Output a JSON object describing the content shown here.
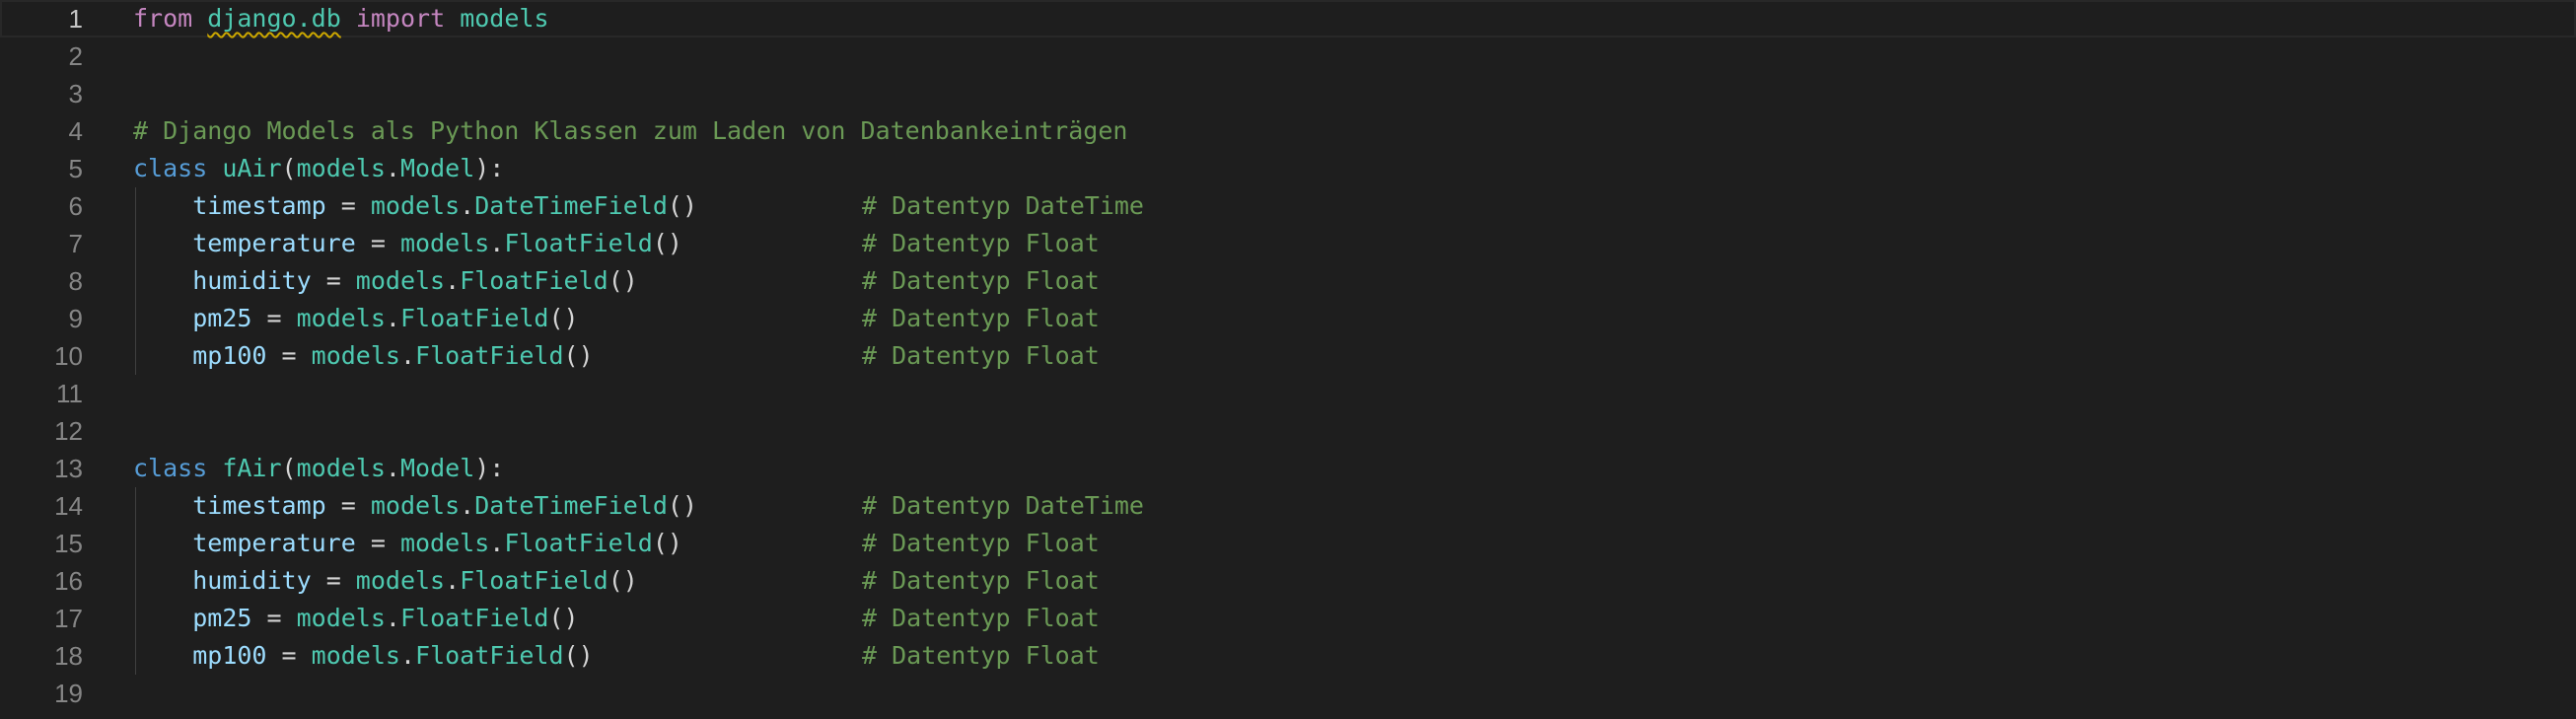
{
  "editor": {
    "current_line": 1,
    "lines": [
      {
        "no": "1",
        "tokens": [
          {
            "t": "from",
            "c": "tok-kw-ctrl"
          },
          {
            "t": " ",
            "c": "tok-plain"
          },
          {
            "t": "django.db",
            "c": "tok-mod squiggle"
          },
          {
            "t": " ",
            "c": "tok-plain"
          },
          {
            "t": "import",
            "c": "tok-kw-ctrl"
          },
          {
            "t": " ",
            "c": "tok-plain"
          },
          {
            "t": "models",
            "c": "tok-mod"
          }
        ],
        "comment": ""
      },
      {
        "no": "2",
        "tokens": [],
        "comment": ""
      },
      {
        "no": "3",
        "tokens": [],
        "comment": ""
      },
      {
        "no": "4",
        "tokens": [
          {
            "t": "# Django Models als Python Klassen zum Laden von Datenbankeinträgen",
            "c": "tok-cmt"
          }
        ],
        "comment": ""
      },
      {
        "no": "5",
        "tokens": [
          {
            "t": "class",
            "c": "tok-kw"
          },
          {
            "t": " ",
            "c": "tok-plain"
          },
          {
            "t": "uAir",
            "c": "tok-cls"
          },
          {
            "t": "(",
            "c": "tok-plain"
          },
          {
            "t": "models",
            "c": "tok-mod"
          },
          {
            "t": ".",
            "c": "tok-plain"
          },
          {
            "t": "Model",
            "c": "tok-cls"
          },
          {
            "t": "):",
            "c": "tok-plain"
          }
        ],
        "comment": ""
      },
      {
        "no": "6",
        "tokens": [
          {
            "t": "    ",
            "c": "tok-plain"
          },
          {
            "t": "timestamp",
            "c": "tok-var"
          },
          {
            "t": " = ",
            "c": "tok-plain"
          },
          {
            "t": "models",
            "c": "tok-mod"
          },
          {
            "t": ".",
            "c": "tok-plain"
          },
          {
            "t": "DateTimeField",
            "c": "tok-cls"
          },
          {
            "t": "()",
            "c": "tok-plain"
          }
        ],
        "comment": "# Datentyp DateTime"
      },
      {
        "no": "7",
        "tokens": [
          {
            "t": "    ",
            "c": "tok-plain"
          },
          {
            "t": "temperature",
            "c": "tok-var"
          },
          {
            "t": " = ",
            "c": "tok-plain"
          },
          {
            "t": "models",
            "c": "tok-mod"
          },
          {
            "t": ".",
            "c": "tok-plain"
          },
          {
            "t": "FloatField",
            "c": "tok-cls"
          },
          {
            "t": "()",
            "c": "tok-plain"
          }
        ],
        "comment": "# Datentyp Float"
      },
      {
        "no": "8",
        "tokens": [
          {
            "t": "    ",
            "c": "tok-plain"
          },
          {
            "t": "humidity",
            "c": "tok-var"
          },
          {
            "t": " = ",
            "c": "tok-plain"
          },
          {
            "t": "models",
            "c": "tok-mod"
          },
          {
            "t": ".",
            "c": "tok-plain"
          },
          {
            "t": "FloatField",
            "c": "tok-cls"
          },
          {
            "t": "()",
            "c": "tok-plain"
          }
        ],
        "comment": "# Datentyp Float"
      },
      {
        "no": "9",
        "tokens": [
          {
            "t": "    ",
            "c": "tok-plain"
          },
          {
            "t": "pm25",
            "c": "tok-var"
          },
          {
            "t": " = ",
            "c": "tok-plain"
          },
          {
            "t": "models",
            "c": "tok-mod"
          },
          {
            "t": ".",
            "c": "tok-plain"
          },
          {
            "t": "FloatField",
            "c": "tok-cls"
          },
          {
            "t": "()",
            "c": "tok-plain"
          }
        ],
        "comment": "# Datentyp Float"
      },
      {
        "no": "10",
        "tokens": [
          {
            "t": "    ",
            "c": "tok-plain"
          },
          {
            "t": "mp100",
            "c": "tok-var"
          },
          {
            "t": " = ",
            "c": "tok-plain"
          },
          {
            "t": "models",
            "c": "tok-mod"
          },
          {
            "t": ".",
            "c": "tok-plain"
          },
          {
            "t": "FloatField",
            "c": "tok-cls"
          },
          {
            "t": "()",
            "c": "tok-plain"
          }
        ],
        "comment": "# Datentyp Float"
      },
      {
        "no": "11",
        "tokens": [],
        "comment": ""
      },
      {
        "no": "12",
        "tokens": [],
        "comment": ""
      },
      {
        "no": "13",
        "tokens": [
          {
            "t": "class",
            "c": "tok-kw"
          },
          {
            "t": " ",
            "c": "tok-plain"
          },
          {
            "t": "fAir",
            "c": "tok-cls"
          },
          {
            "t": "(",
            "c": "tok-plain"
          },
          {
            "t": "models",
            "c": "tok-mod"
          },
          {
            "t": ".",
            "c": "tok-plain"
          },
          {
            "t": "Model",
            "c": "tok-cls"
          },
          {
            "t": "):",
            "c": "tok-plain"
          }
        ],
        "comment": ""
      },
      {
        "no": "14",
        "tokens": [
          {
            "t": "    ",
            "c": "tok-plain"
          },
          {
            "t": "timestamp",
            "c": "tok-var"
          },
          {
            "t": " = ",
            "c": "tok-plain"
          },
          {
            "t": "models",
            "c": "tok-mod"
          },
          {
            "t": ".",
            "c": "tok-plain"
          },
          {
            "t": "DateTimeField",
            "c": "tok-cls"
          },
          {
            "t": "()",
            "c": "tok-plain"
          }
        ],
        "comment": "# Datentyp DateTime"
      },
      {
        "no": "15",
        "tokens": [
          {
            "t": "    ",
            "c": "tok-plain"
          },
          {
            "t": "temperature",
            "c": "tok-var"
          },
          {
            "t": " = ",
            "c": "tok-plain"
          },
          {
            "t": "models",
            "c": "tok-mod"
          },
          {
            "t": ".",
            "c": "tok-plain"
          },
          {
            "t": "FloatField",
            "c": "tok-cls"
          },
          {
            "t": "()",
            "c": "tok-plain"
          }
        ],
        "comment": "# Datentyp Float"
      },
      {
        "no": "16",
        "tokens": [
          {
            "t": "    ",
            "c": "tok-plain"
          },
          {
            "t": "humidity",
            "c": "tok-var"
          },
          {
            "t": " = ",
            "c": "tok-plain"
          },
          {
            "t": "models",
            "c": "tok-mod"
          },
          {
            "t": ".",
            "c": "tok-plain"
          },
          {
            "t": "FloatField",
            "c": "tok-cls"
          },
          {
            "t": "()",
            "c": "tok-plain"
          }
        ],
        "comment": "# Datentyp Float"
      },
      {
        "no": "17",
        "tokens": [
          {
            "t": "    ",
            "c": "tok-plain"
          },
          {
            "t": "pm25",
            "c": "tok-var"
          },
          {
            "t": " = ",
            "c": "tok-plain"
          },
          {
            "t": "models",
            "c": "tok-mod"
          },
          {
            "t": ".",
            "c": "tok-plain"
          },
          {
            "t": "FloatField",
            "c": "tok-cls"
          },
          {
            "t": "()",
            "c": "tok-plain"
          }
        ],
        "comment": "# Datentyp Float"
      },
      {
        "no": "18",
        "tokens": [
          {
            "t": "    ",
            "c": "tok-plain"
          },
          {
            "t": "mp100",
            "c": "tok-var"
          },
          {
            "t": " = ",
            "c": "tok-plain"
          },
          {
            "t": "models",
            "c": "tok-mod"
          },
          {
            "t": ".",
            "c": "tok-plain"
          },
          {
            "t": "FloatField",
            "c": "tok-cls"
          },
          {
            "t": "()",
            "c": "tok-plain"
          }
        ],
        "comment": "# Datentyp Float"
      },
      {
        "no": "19",
        "tokens": [],
        "comment": ""
      }
    ]
  }
}
